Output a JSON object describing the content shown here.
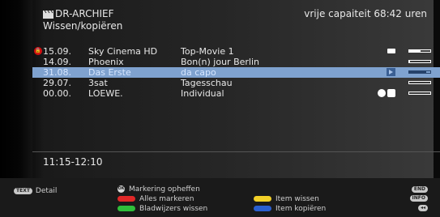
{
  "header": {
    "title": "DR-ARCHIEF",
    "subtitle": "Wissen/kopiëren",
    "capacity": "vrije capaiteit 68:42 uren",
    "icon": "clapperboard-icon"
  },
  "recordings": [
    {
      "date": "15.09.",
      "channel": "Sky Cinema HD",
      "title": "Top-Movie 1",
      "icons": [
        "lock-icon",
        "key-icon"
      ],
      "progress": 0.55,
      "selected": false
    },
    {
      "date": "14.09.",
      "channel": "Phoenix",
      "title": "Bon(n) jour Berlin",
      "icons": [],
      "progress": 0.05,
      "selected": false
    },
    {
      "date": "31.08.",
      "channel": "Das Erste",
      "title": "da capo",
      "icons": [
        "play-icon"
      ],
      "progress": 0.8,
      "selected": true
    },
    {
      "date": "29.07.",
      "channel": "3sat",
      "title": "Tagesschau",
      "icons": [],
      "progress": 0.0,
      "selected": false
    },
    {
      "date": "00.00.",
      "channel": "LOEWE.",
      "title": "Individual",
      "icons": [
        "timer-icon",
        "camera-icon"
      ],
      "progress": 0.0,
      "selected": false
    }
  ],
  "time_range": "11:15-12:10",
  "footer": {
    "detail_key": "TEXT",
    "detail_label": "Detail",
    "ok_key": "OK",
    "unmark_label": "Markering opheffen",
    "mark_all_label": "Alles markeren",
    "delete_bookmarks_label": "Bladwijzers wissen",
    "delete_item_label": "Item wissen",
    "copy_item_label": "Item kopiëren",
    "end_key": "END",
    "info_key": "INFO",
    "rewind_key": "◂◂",
    "colors": {
      "red": "#e02828",
      "green": "#2fbf3a",
      "yellow": "#f2d028",
      "blue": "#2a5fd0"
    }
  }
}
